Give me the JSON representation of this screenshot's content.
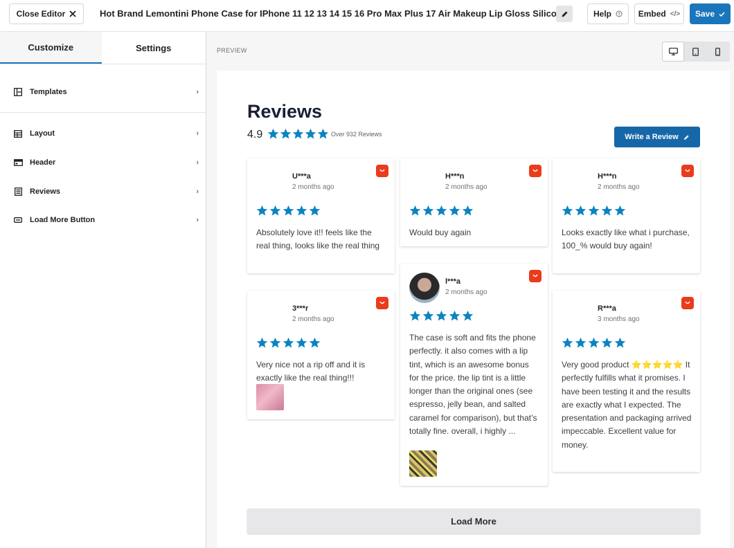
{
  "topbar": {
    "close_label": "Close Editor",
    "title": "Hot Brand Lemontini Phone Case for IPhone 11 12 13 14 15 16 Pro Max Plus 17 Air Makeup Lip Gloss Silicone",
    "help_label": "Help",
    "embed_label": "Embed",
    "save_label": "Save"
  },
  "sidebar": {
    "tabs": [
      {
        "label": "Customize",
        "active": true
      },
      {
        "label": "Settings",
        "active": false
      }
    ],
    "items": [
      {
        "label": "Templates",
        "icon": "templates-icon"
      },
      {
        "label": "Layout",
        "icon": "layout-icon"
      },
      {
        "label": "Header",
        "icon": "header-icon"
      },
      {
        "label": "Reviews",
        "icon": "reviews-icon"
      },
      {
        "label": "Load More Button",
        "icon": "load-more-icon"
      }
    ]
  },
  "preview": {
    "label": "PREVIEW",
    "devices": [
      "desktop-icon",
      "tablet-icon",
      "mobile-icon"
    ],
    "active_device": "desktop"
  },
  "widget": {
    "title": "Reviews",
    "average": "4.9",
    "rating_fraction": 0.98,
    "count_text": "Over 932 Reviews",
    "write_label": "Write a Review",
    "load_more_label": "Load More",
    "accent_color": "#1a75bb",
    "star_color": "#0a84c1",
    "badge_color": "#ea3b1d"
  },
  "reviews": [
    {
      "name": "U***a",
      "date": "2 months ago",
      "rating": 5,
      "text": "Absolutely love it!! feels like the real thing, looks like the real thing"
    },
    {
      "name": "H***n",
      "date": "2 months ago",
      "rating": 5,
      "text": "Would buy again"
    },
    {
      "name": "H***n",
      "date": "2 months ago",
      "rating": 5,
      "text": "Looks exactly like what i purchase, 100_% would buy again!"
    },
    {
      "name": "3***r",
      "date": "2 months ago",
      "rating": 5,
      "text": "Very nice not a rip off and it is exactly like the real thing!!!"
    },
    {
      "name": "l***a",
      "date": "2 months ago",
      "rating": 5,
      "text": "The case is soft and fits the phone perfectly. it also comes with a lip tint, which is an awesome bonus for the price. the lip tint is a little longer than the original ones (see espresso, jelly bean, and salted caramel for comparison), but that’s totally fine. overall, i highly ..."
    },
    {
      "name": "R***a",
      "date": "3 months ago",
      "rating": 5,
      "text": "Very good product ⭐⭐⭐⭐⭐ It perfectly fulfills what it promises. I have been testing it and the results are exactly what I expected. The presentation and packaging arrived impeccable. Excellent value for money."
    }
  ]
}
